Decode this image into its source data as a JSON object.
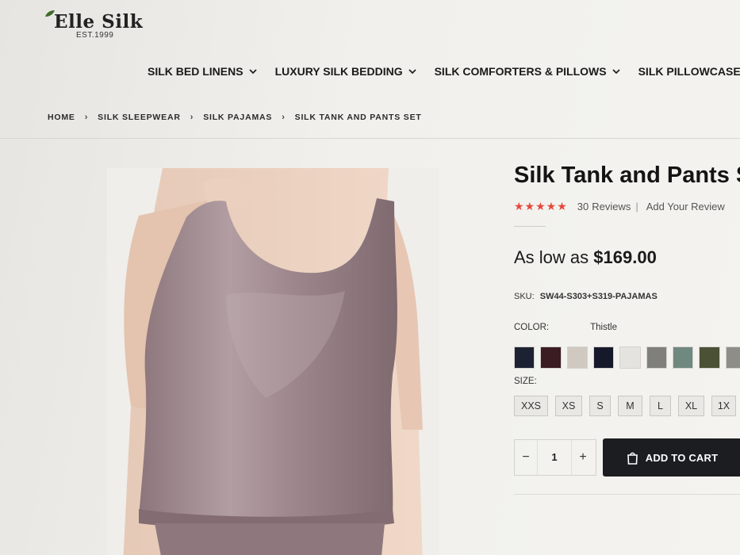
{
  "brand": {
    "name": "Elle Silk",
    "est": "EST.1999"
  },
  "nav": {
    "items": [
      {
        "label": "SILK BED LINENS"
      },
      {
        "label": "LUXURY SILK BEDDING"
      },
      {
        "label": "SILK COMFORTERS & PILLOWS"
      },
      {
        "label": "SILK PILLOWCASES"
      }
    ]
  },
  "breadcrumb": {
    "items": [
      {
        "label": "HOME"
      },
      {
        "label": "SILK SLEEPWEAR"
      },
      {
        "label": "SILK PAJAMAS"
      },
      {
        "label": "SILK TANK AND PANTS SET"
      }
    ],
    "separator": "›"
  },
  "product": {
    "title": "Silk Tank and Pants Set",
    "stars": "★★★★★",
    "review_count": "30",
    "reviews_label": "Reviews",
    "review_separator": "|",
    "add_review": "Add Your Review",
    "price_prefix": "As low as",
    "price": "$169.00",
    "sku_label": "SKU:",
    "sku": "SW44-S303+S319-PAJAMAS",
    "color_label": "COLOR:",
    "color_value": "Thistle",
    "swatches": [
      "#1d2233",
      "#3a1c22",
      "#cfc9c1",
      "#16192a",
      "#e4e3df",
      "#7f7f7c",
      "#6f8880",
      "#4b5135",
      "#8f8d88"
    ],
    "size_label": "SIZE:",
    "sizes": [
      "XXS",
      "XS",
      "S",
      "M",
      "L",
      "XL",
      "1X"
    ],
    "qty": {
      "minus": "−",
      "value": "1",
      "plus": "+"
    },
    "add_to_cart": "ADD TO CART"
  },
  "colors": {
    "accent_star": "#e5483e",
    "cart_button": "#1c1d21",
    "garment": "#a0898e"
  }
}
